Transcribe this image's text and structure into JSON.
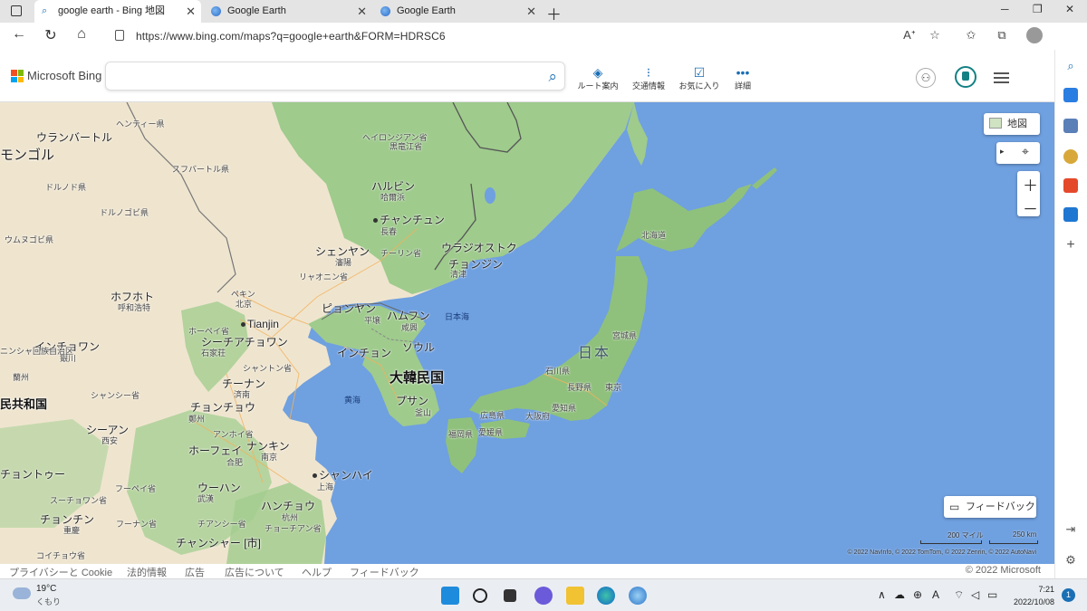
{
  "browser": {
    "tabs": [
      {
        "title": "google earth - Bing 地図",
        "active": true
      },
      {
        "title": "Google Earth",
        "active": false
      },
      {
        "title": "Google Earth",
        "active": false
      }
    ],
    "url": "https://www.bing.com/maps?q=google+earth&FORM=HDRSC6"
  },
  "bing": {
    "brand": "Microsoft Bing",
    "search_value": "",
    "tools": [
      {
        "label": "ルート案内",
        "icon": "directions-icon"
      },
      {
        "label": "交通情報",
        "icon": "traffic-icon"
      },
      {
        "label": "お気に入り",
        "icon": "favorites-icon"
      },
      {
        "label": "詳細",
        "icon": "more-icon"
      }
    ]
  },
  "map": {
    "view_button": "地図",
    "feedback_button": "フィードバック",
    "scale_miles": "200 マイル",
    "scale_km": "250 km",
    "copyright": "© 2022 NavInfo, © 2022 TomTom, © 2022 Zenrin, © 2022 AutoNavi",
    "labels": {
      "ulaanbaatar": "ウランバートル",
      "mongolia": "モンゴル",
      "hentiy": "ヘンティー県",
      "sukhbaatar": "スフバートル県",
      "dornod": "ドルノド県",
      "dornogovi": "ドルノゴビ県",
      "umnugovi": "ウムヌゴビ県",
      "heilongjiang": "ヘイロンジアン省",
      "heilongjiang_kanji": "黒竜江省",
      "harbin": "ハルビン",
      "harbin_kanji": "哈爾浜",
      "changchun": "チャンチュン",
      "changchun_kanji": "長春",
      "jilin": "チーリン省",
      "shenyang": "シェンヤン",
      "shenyang_kanji": "瀋陽",
      "liaoning": "リャオニン省",
      "vladivostok": "ウラジオストク",
      "chongjin": "チョンジン",
      "chongjin_kanji": "清津",
      "hohhot": "ホフホト",
      "hohhot_kanji": "呼和浩特",
      "beijing": "ペキン",
      "beijing_kanji": "北京",
      "tianjin": "Tianjin",
      "hebei": "ホーペイ省",
      "shijiazhuang": "シーチアチョワン",
      "shijiazhuang_kanji": "石家荘",
      "yinchuan": "インチョワン",
      "yinchuan_kanji": "銀川",
      "lanzhou": "蘭州",
      "china": "民共和国",
      "shandong": "シャントン省",
      "jinan": "チーナン",
      "jinan_kanji": "済南",
      "zhengzhou": "チョンチョウ",
      "zhengzhou_kanji": "鄭州",
      "shanxi": "シャンシー省",
      "xian": "シーアン",
      "xian_kanji": "西安",
      "pyongyang": "ピョンヤン",
      "pyongyang_kanji": "平壌",
      "hamhung": "ハムフン",
      "hamhung_kanji": "咸興",
      "incheon": "インチョン",
      "seoul": "ソウル",
      "korea": "大韓民国",
      "busan": "プサン",
      "busan_kanji": "釜山",
      "yellow_sea": "黄海",
      "sea_of_japan": "日本海",
      "japan": "日本",
      "hokkaido": "北海道",
      "miyagi": "宮城県",
      "ishikawa": "石川県",
      "nagano": "長野県",
      "tokyo": "東京",
      "aichi": "愛知県",
      "osaka": "大阪府",
      "hiroshima": "広島県",
      "fukuoka": "福岡県",
      "ehime": "愛媛県",
      "hefei": "ホーフェイ",
      "hefei_kanji": "合肥",
      "nanjing": "ナンキン",
      "nanjing_kanji": "南京",
      "anhui": "アンホイ省",
      "shanghai": "シャンハイ",
      "shanghai_kanji": "上海",
      "chengdu": "チョントゥー",
      "wuhan": "ウーハン",
      "wuhan_kanji": "武漢",
      "hubei": "フーペイ省",
      "hangzhou": "ハンチョウ",
      "hangzhou_kanji": "杭州",
      "zhejiang": "チョーチアン省",
      "chongqing": "チョンチン",
      "chongqing_kanji": "重慶",
      "hunan": "フーナン省",
      "jiangxi": "チアンシー省",
      "changsha": "チャンシャー [市]",
      "guizhou": "コイチョウ省",
      "sichuan": "スーチョワン省",
      "ningxia": "ニンシャ回族自治区"
    }
  },
  "footer": {
    "links": [
      "プライバシーと Cookie",
      "法的情報",
      "広告",
      "広告について",
      "ヘルプ",
      "フィードバック"
    ],
    "copyright": "© 2022 Microsoft"
  },
  "taskbar": {
    "temperature": "19°C",
    "condition": "くもり",
    "time": "7:21",
    "date": "2022/10/08",
    "notifications": "1"
  },
  "colors": {
    "ocean": "#6fa0e0",
    "land_green": "#9fcb8d",
    "land_tan": "#efe5cf",
    "accent": "#1a6fb5"
  }
}
